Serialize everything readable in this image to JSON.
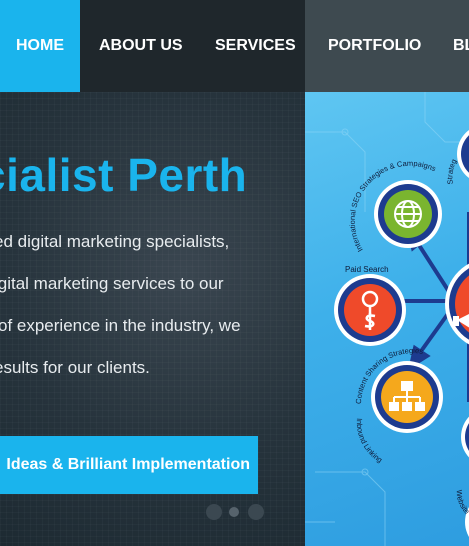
{
  "nav": {
    "items": [
      {
        "label": "HOME",
        "active": true
      },
      {
        "label": "ABOUT US",
        "active": false
      },
      {
        "label": "SERVICES",
        "active": false
      },
      {
        "label": "PORTFOLIO",
        "active": false
      },
      {
        "label": "BL",
        "active": false
      }
    ]
  },
  "hero": {
    "title": "cialist Perth",
    "lines": [
      "ed digital marketing specialists,",
      "igital marketing services to our",
      "of experience in the industry, we",
      "esults for our clients."
    ],
    "cta_label": "Ideas & Brilliant Implementation",
    "slider": {
      "dots": 3,
      "active_index": 1
    }
  },
  "diagram": {
    "labels": {
      "intl_seo": "International SEO Strategies & Campaigns",
      "strategies": "Strateg",
      "paid_search": "Paid Search",
      "content": "Content Sharing Strategies",
      "inbound": "Inbound Linking",
      "website": "Website"
    },
    "icons": [
      "globe-icon",
      "money-search-icon",
      "sitemap-icon",
      "megaphone-icon"
    ]
  },
  "colors": {
    "accent": "#1ab4ed",
    "nav_bg": "#1f272c",
    "ring_blue": "#1d3b8f",
    "node_green": "#7ab52f",
    "node_red": "#ef4a2a",
    "node_orange": "#f5a81c"
  }
}
